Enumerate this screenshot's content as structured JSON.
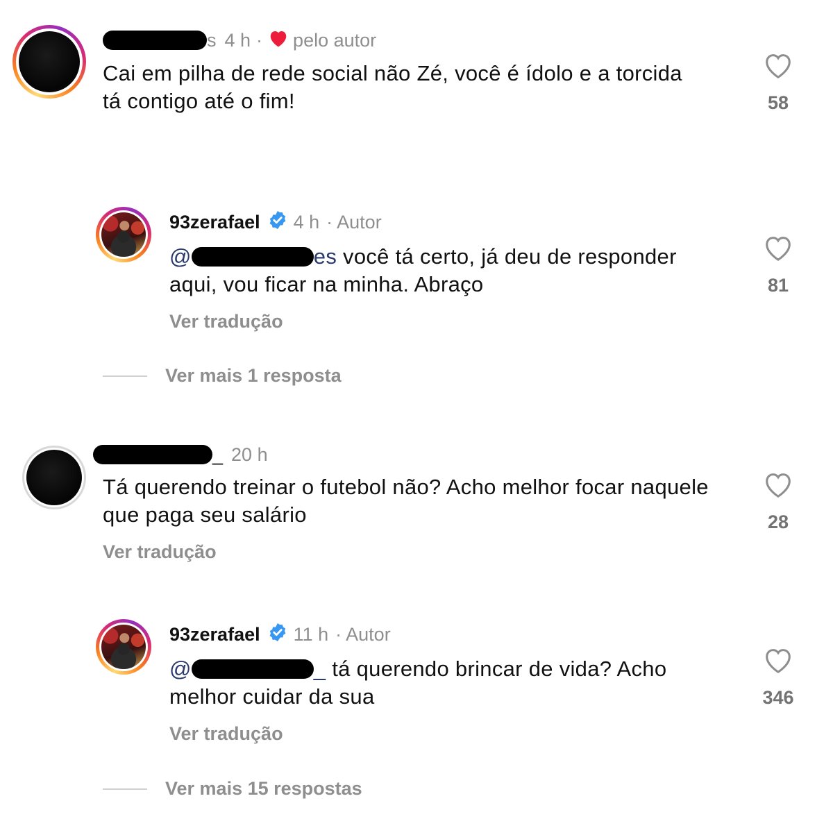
{
  "comments": [
    {
      "username_suffix": "s",
      "time": "4 h",
      "separator": "·",
      "liked_by_author": "pelo autor",
      "text": "Cai em pilha de rede social não Zé, você é ídolo e a torcida tá contigo até o fim!",
      "likes": "58"
    },
    {
      "username": "93zerafael",
      "time": "4 h",
      "role": "· Autor",
      "mention_prefix": "@",
      "mention_suffix": "es",
      "text": " você tá certo, já deu de responder aqui, vou ficar na minha. Abraço",
      "translate": "Ver tradução",
      "likes": "81"
    },
    {
      "view_more": "Ver mais 1 resposta"
    },
    {
      "username_suffix": "_",
      "time": "20 h",
      "text": "Tá querendo treinar o futebol não? Acho melhor focar naquele que paga seu salário",
      "translate": "Ver tradução",
      "likes": "28"
    },
    {
      "username": "93zerafael",
      "time": "11 h",
      "role": "· Autor",
      "mention_prefix": "@",
      "mention_suffix": "_",
      "text": " tá querendo brincar de vida? Acho melhor cuidar da sua",
      "translate": "Ver tradução",
      "likes": "346"
    },
    {
      "view_more": "Ver mais 15 respostas"
    }
  ],
  "icons": {
    "like": "heart-outline-icon",
    "liked_by_author": "heart-filled-icon",
    "verified": "verified-badge-icon"
  },
  "colors": {
    "liked_heart": "#ed1c3a",
    "verified": "#3897f0",
    "secondary_text": "#8e8e8e"
  }
}
